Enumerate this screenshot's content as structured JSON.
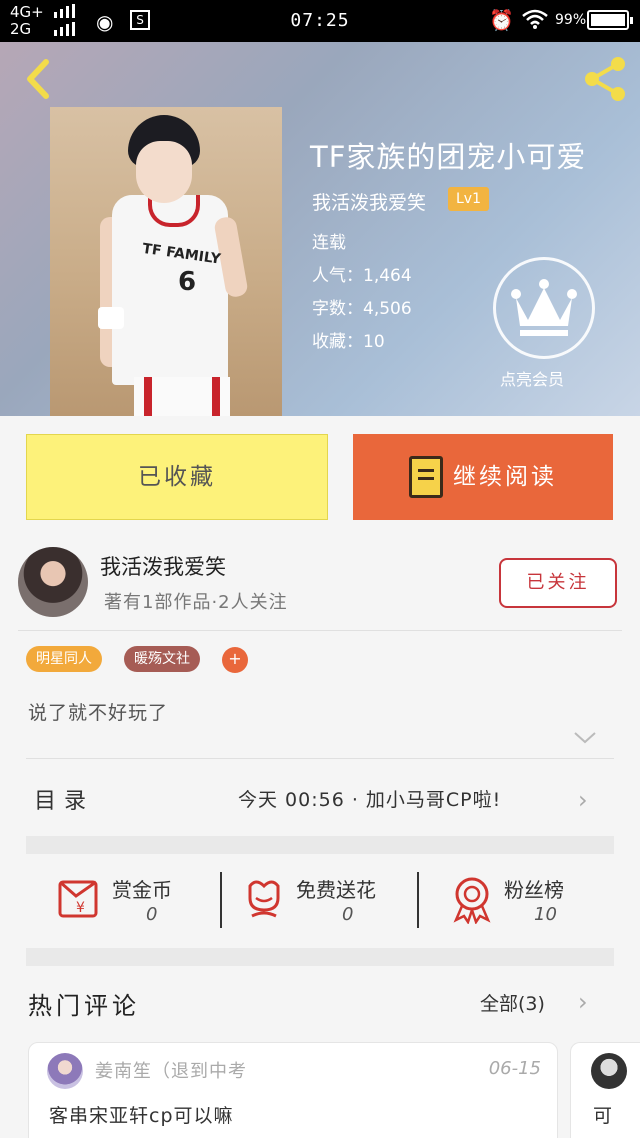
{
  "status_bar": {
    "network_1": "4G+",
    "network_2": "2G",
    "time": "07:25",
    "battery": "99%",
    "battery_level": 0.99
  },
  "header": {
    "back_icon": "chevron-left-icon",
    "share_icon": "share-icon"
  },
  "book": {
    "title": "TF家族的团宠小可爱",
    "author": "我活泼我爱笑",
    "level": "Lv1",
    "status": "连载",
    "popularity": "人气：1,464",
    "word_count": "字数：4,506",
    "favorites": "收藏：10",
    "vip_label": "点亮会员",
    "cover_jersey_text": "TF FAMILY",
    "cover_jersey_number": "6"
  },
  "actions": {
    "favorited_label": "已收藏",
    "continue_label": "继续阅读",
    "colors": {
      "fav_bg": "#fdf27a",
      "read_bg": "#e9673b"
    }
  },
  "author_card": {
    "name": "我活泼我爱笑",
    "works": "著有1部作品·2人关注",
    "follow_label": "已关注"
  },
  "tags": [
    {
      "label": "明星同人",
      "color": "#f2a93b"
    },
    {
      "label": "暖殇文社",
      "color": "#a65c55"
    }
  ],
  "tag_add_label": "+",
  "synopsis": "说了就不好玩了",
  "toc": {
    "label": "目录",
    "latest": "今天  00:56 · 加小马哥CP啦!",
    "arrow": "›"
  },
  "stats": [
    {
      "label": "赏金币",
      "value": "0",
      "icon": "red-envelope-icon"
    },
    {
      "label": "免费送花",
      "value": "0",
      "icon": "flower-icon"
    },
    {
      "label": "粉丝榜",
      "value": "10",
      "icon": "medal-icon"
    }
  ],
  "comments_section": {
    "title": "热门评论",
    "all_label": "全部(3)",
    "arrow": "›",
    "comments": [
      {
        "user": "姜南笙（退到中考",
        "date": "06-15",
        "text": "客串宋亚轩cp可以嘛"
      },
      {
        "text": "可"
      }
    ]
  }
}
